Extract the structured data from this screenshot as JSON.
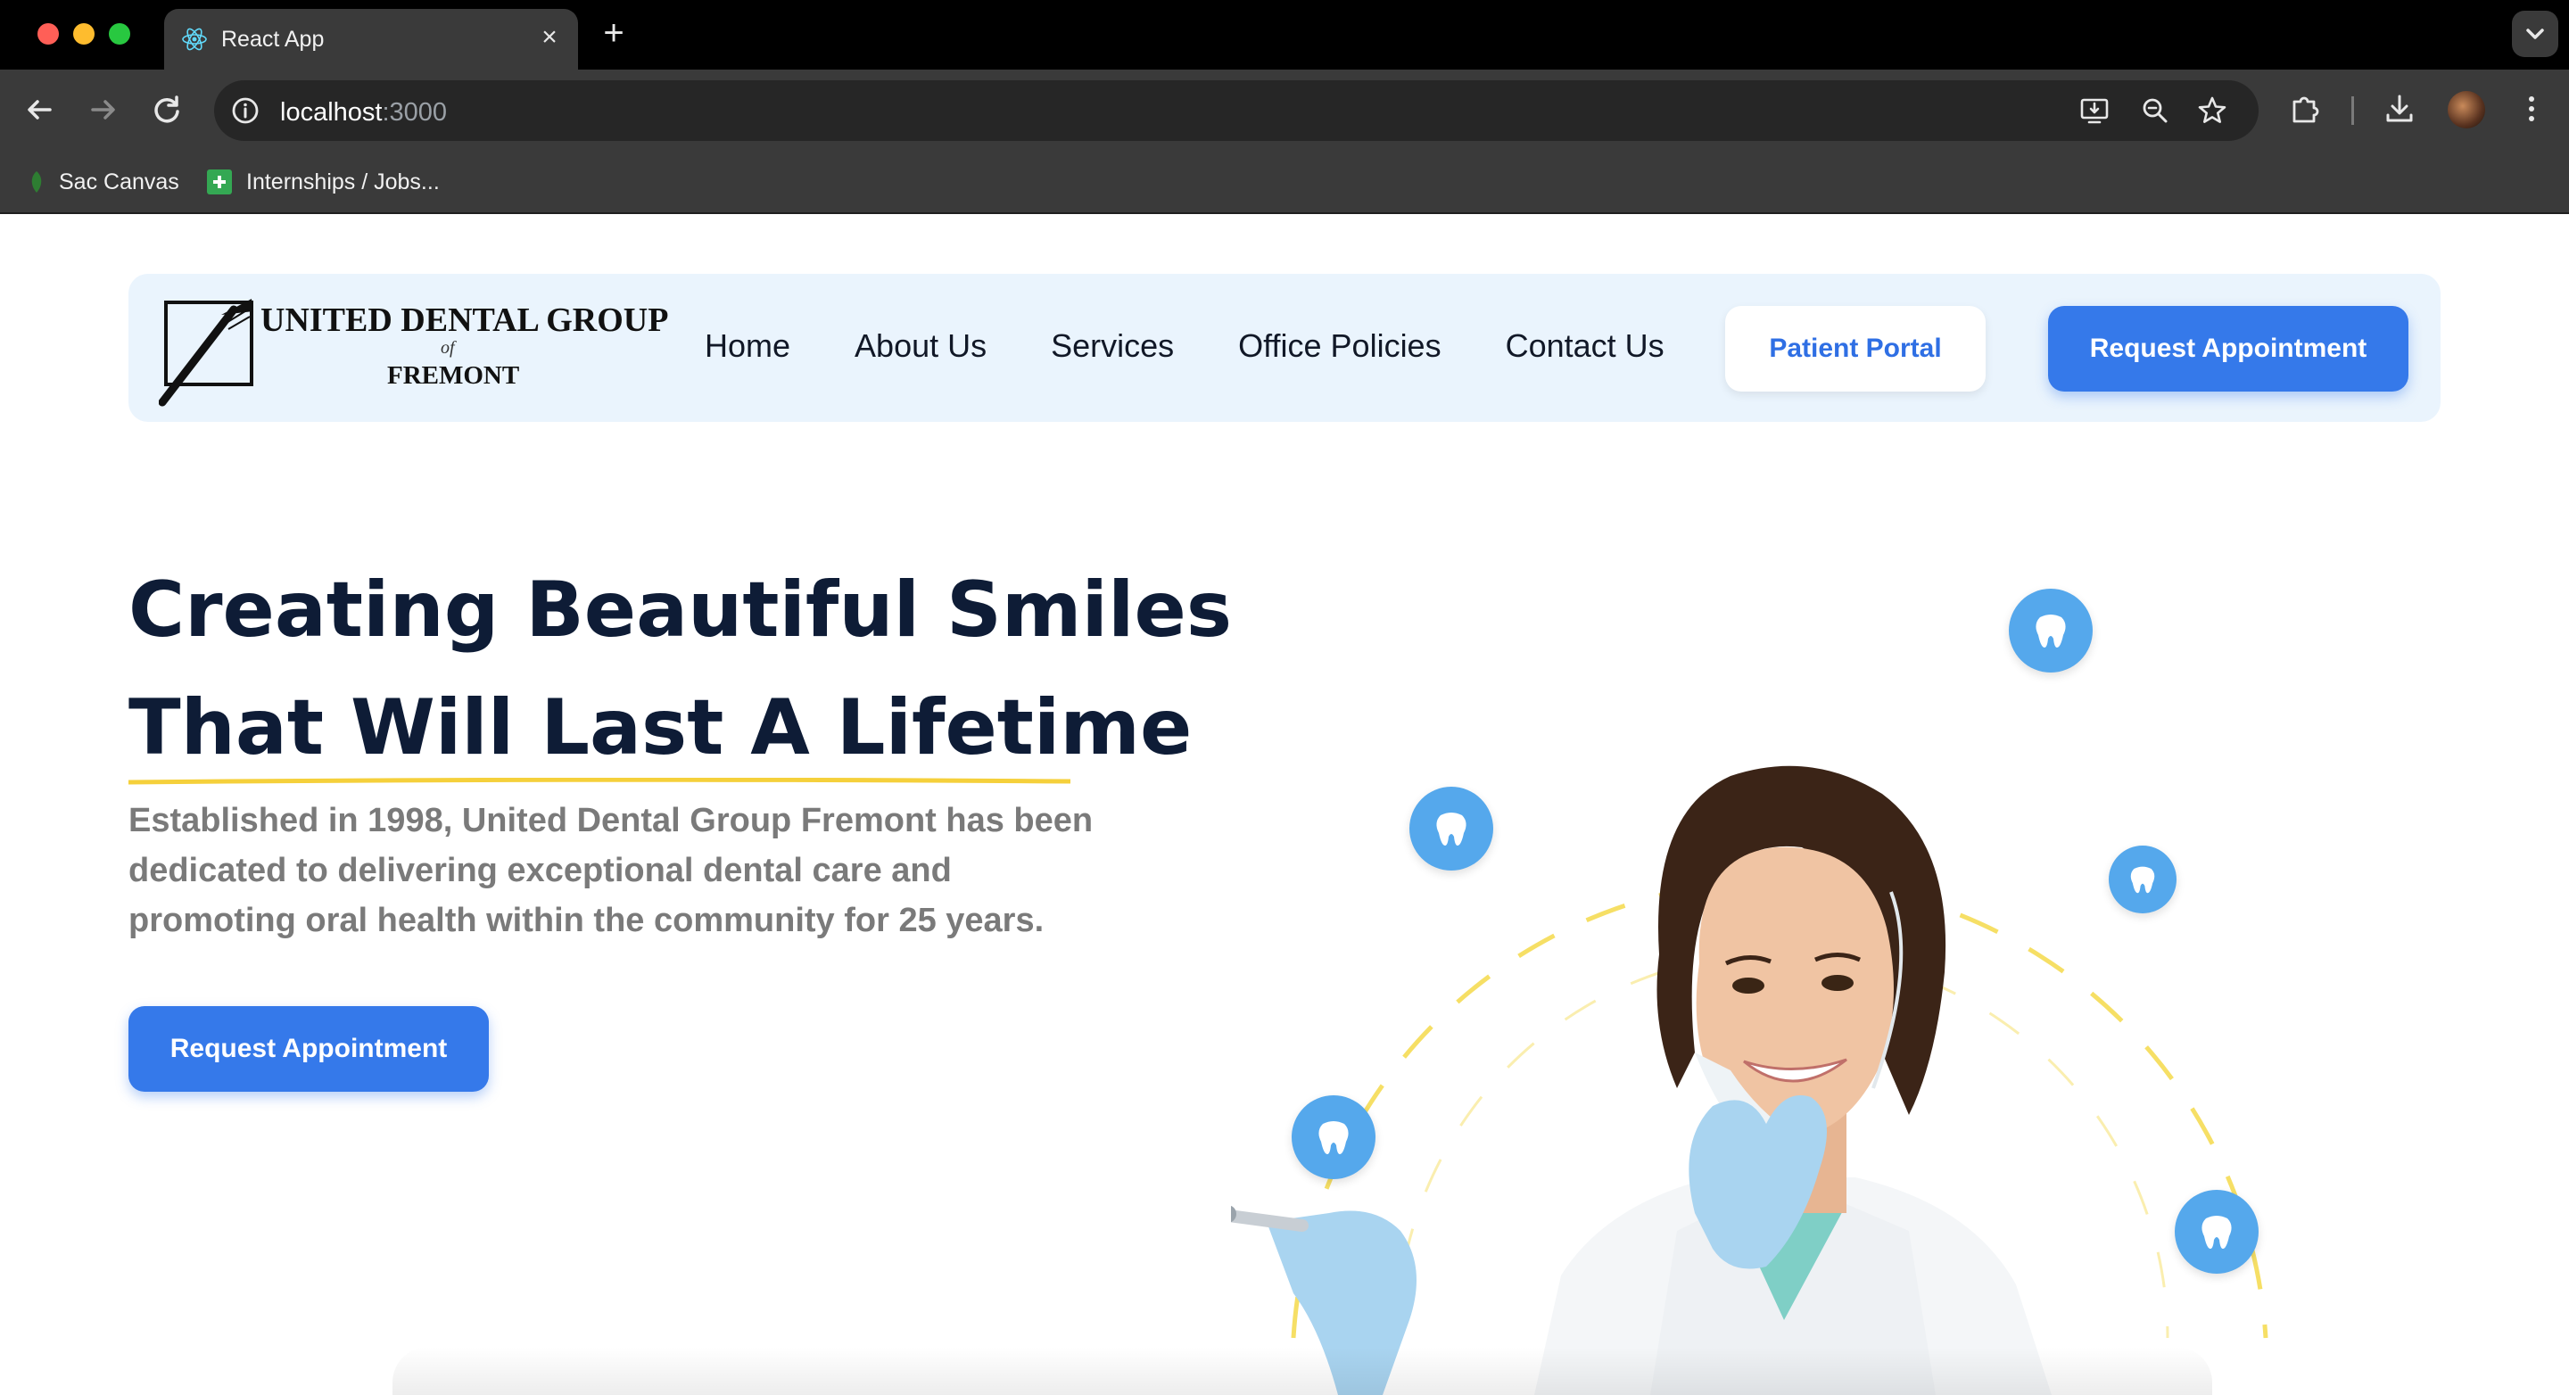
{
  "browser": {
    "tab_title": "React App",
    "new_tab_icon": "plus-icon",
    "url_host": "localhost",
    "url_port": ":3000",
    "bookmarks": [
      {
        "label": "Sac Canvas"
      },
      {
        "label": "Internships / Jobs..."
      }
    ]
  },
  "site": {
    "logo": {
      "line1": "UNITED DENTAL GROUP",
      "of": "of",
      "line2": "FREMONT"
    },
    "nav": {
      "items": [
        "Home",
        "About Us",
        "Services",
        "Office Policies",
        "Contact Us"
      ],
      "patient_portal": "Patient Portal",
      "request_appointment": "Request Appointment"
    },
    "hero": {
      "title_line1": "Creating Beautiful Smiles",
      "title_line2": "That Will Last A Lifetime",
      "description": "Established in 1998, United Dental Group Fremont has been dedicated to delivering exceptional dental care and promoting oral health within the community for 25 years.",
      "cta": "Request Appointment"
    }
  },
  "colors": {
    "primary": "#3579ea",
    "nav_bg": "#eaf4fd",
    "heading": "#0e1c36",
    "accent_yellow": "#f5d03b",
    "tooth_bubble": "#55a8ec"
  }
}
